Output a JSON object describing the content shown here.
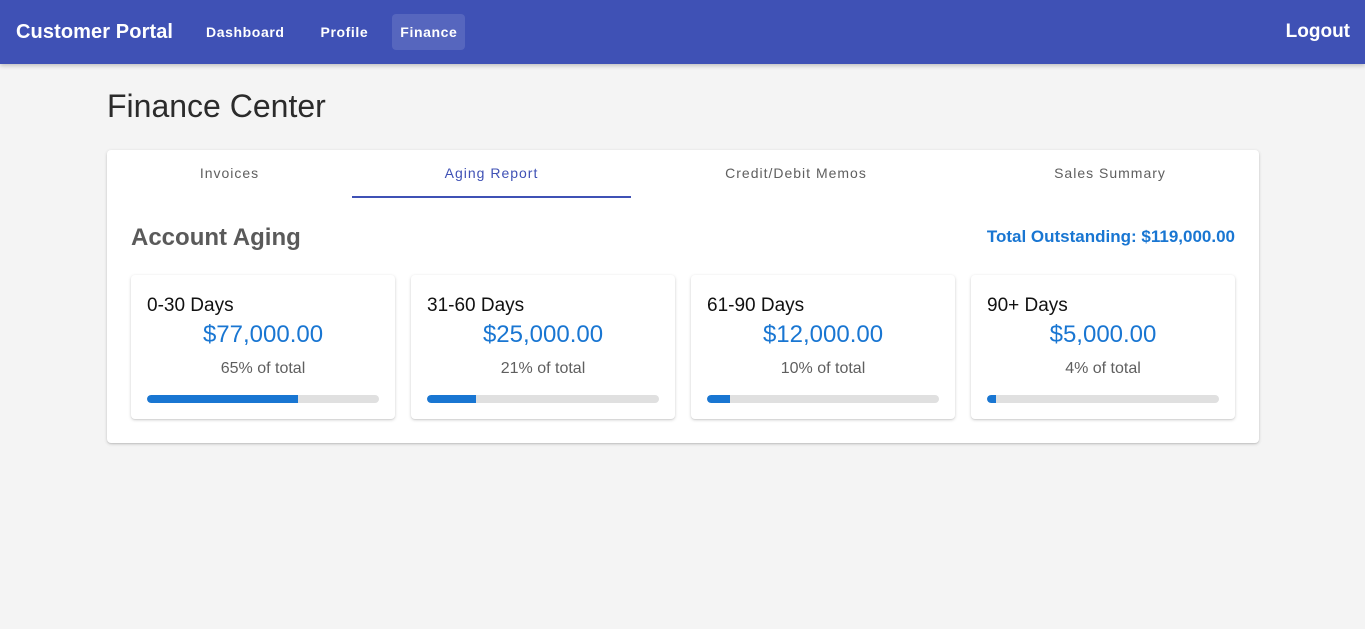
{
  "app": {
    "title": "Customer Portal",
    "logout_label": "Logout"
  },
  "nav": {
    "items": [
      {
        "label": "Dashboard",
        "active": false
      },
      {
        "label": "Profile",
        "active": false
      },
      {
        "label": "Finance",
        "active": true
      }
    ]
  },
  "page": {
    "title": "Finance Center"
  },
  "tabs": {
    "items": [
      {
        "label": "Invoices",
        "active": false
      },
      {
        "label": "Aging Report",
        "active": true
      },
      {
        "label": "Credit/Debit Memos",
        "active": false
      },
      {
        "label": "Sales Summary",
        "active": false
      }
    ]
  },
  "aging": {
    "title": "Account Aging",
    "total_outstanding": "Total Outstanding: $119,000.00",
    "buckets": [
      {
        "label": "0-30 Days",
        "amount": "$77,000.00",
        "percent_text": "65% of total",
        "percent": 65
      },
      {
        "label": "31-60 Days",
        "amount": "$25,000.00",
        "percent_text": "21% of total",
        "percent": 21
      },
      {
        "label": "61-90 Days",
        "amount": "$12,000.00",
        "percent_text": "10% of total",
        "percent": 10
      },
      {
        "label": "90+ Days",
        "amount": "$5,000.00",
        "percent_text": "4% of total",
        "percent": 4
      }
    ]
  },
  "colors": {
    "appbar": "#3f51b5",
    "accent": "#1976d2",
    "tab_active": "#3f51b5",
    "background": "#f4f4f4"
  }
}
